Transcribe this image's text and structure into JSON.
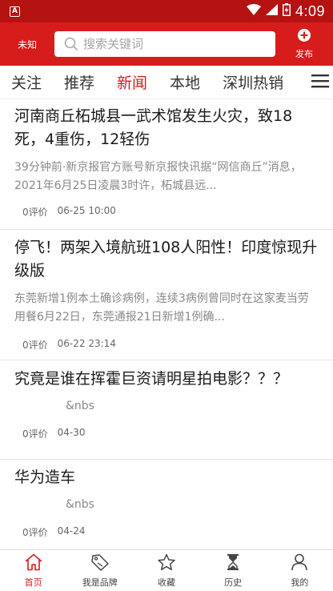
{
  "status_bar": {
    "time": "4:09",
    "app_icon": "A"
  },
  "header": {
    "left_label": "未知",
    "search_placeholder": "搜索关键词",
    "publish_label": "发布"
  },
  "tabs": [
    "关注",
    "推荐",
    "新闻",
    "本地",
    "深圳热销"
  ],
  "active_tab": 2,
  "news": [
    {
      "title": "河南商丘柘城县一武术馆发生火灾，致18死，4重伤，12轻伤",
      "summary": "39分钟前·新京报官方账号新京报快讯据“网信商丘”消息，2021年6月25日凌晨3时许，柘城县远...",
      "comments": "0评价",
      "time": "06-25 10:00"
    },
    {
      "title": "停飞！两架入境航班108人阳性！印度惊现升级版",
      "summary": "东莞新增1例本土确诊病例，连续3病例曾同时在这家麦当劳用餐6月22日，东莞通报21日新增1例确...",
      "comments": "0评价",
      "time": "06-22 23:14"
    },
    {
      "title": "究竟是谁在挥霍巨资请明星拍电影？？？",
      "summary": "&nbs",
      "comments": "0评价",
      "time": "04-30"
    },
    {
      "title": "华为造车",
      "summary": "&nbs",
      "comments": "0评价",
      "time": "04-24"
    }
  ],
  "bottom_nav": [
    "首页",
    "我是品牌",
    "收藏",
    "历史",
    "我的"
  ],
  "colors": {
    "brand_red": "#d71c1c",
    "status_red": "#b51212"
  }
}
